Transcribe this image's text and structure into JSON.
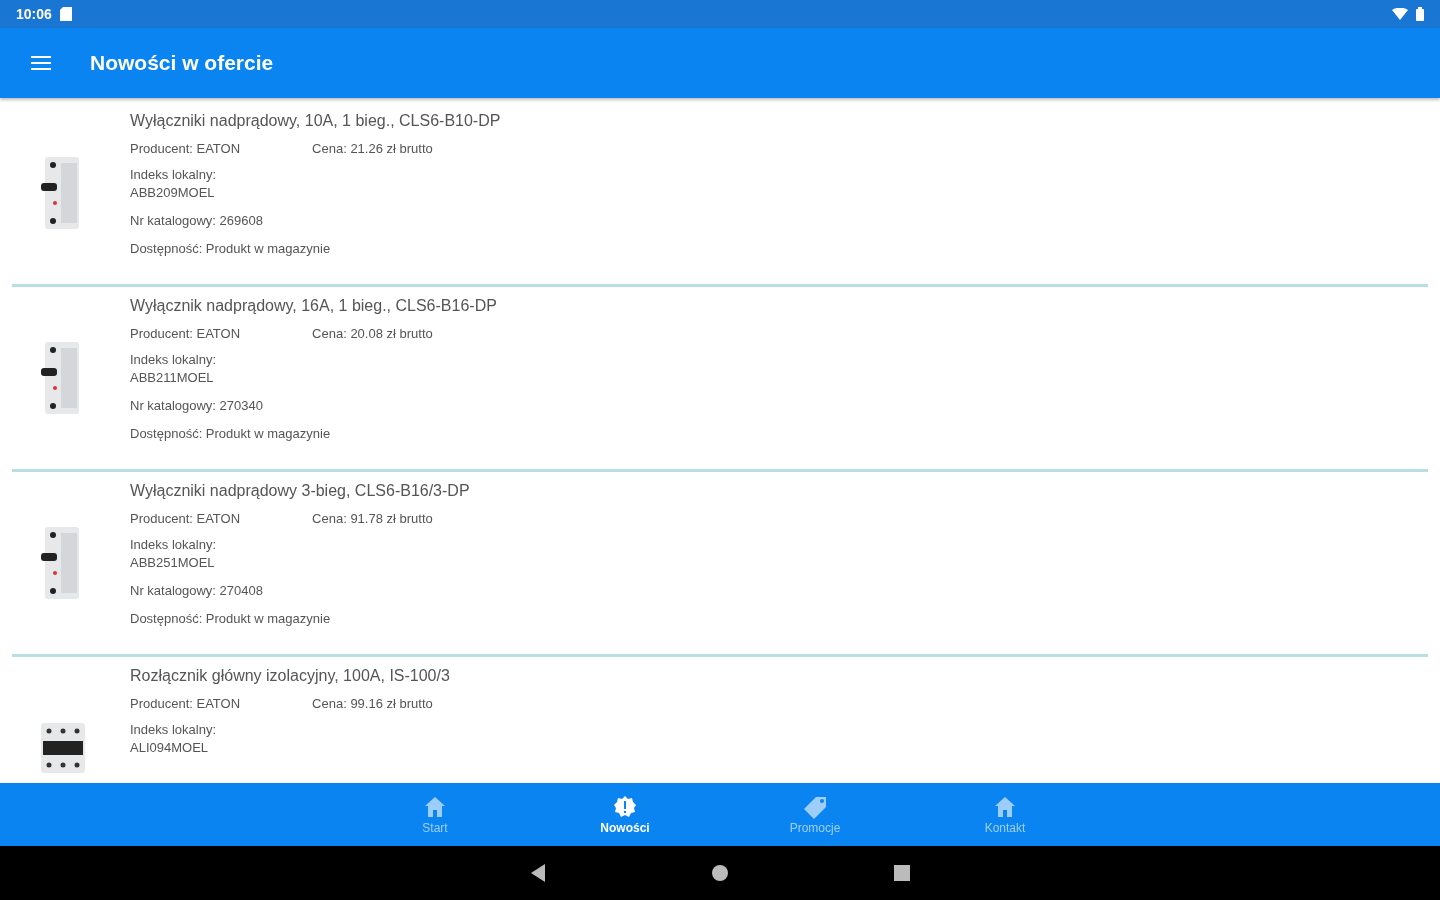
{
  "status_bar": {
    "time": "10:06"
  },
  "app_bar": {
    "title": "Nowości w ofercie"
  },
  "products": [
    {
      "name": "Wyłączniki nadprądowy, 10A, 1 bieg., CLS6-B10-DP",
      "producer": "Producent: EATON",
      "price": "Cena: 21.26 zł brutto",
      "local_index_label": "Indeks lokalny:",
      "local_index": "ABB209MOEL",
      "catalog_no": "Nr katalogowy: 269608",
      "availability": "Dostępność: Produkt w magazynie",
      "kind": "single"
    },
    {
      "name": "Wyłącznik nadprądowy, 16A, 1 bieg., CLS6-B16-DP",
      "producer": "Producent: EATON",
      "price": "Cena: 20.08 zł brutto",
      "local_index_label": "Indeks lokalny:",
      "local_index": "ABB211MOEL",
      "catalog_no": "Nr katalogowy: 270340",
      "availability": "Dostępność: Produkt w magazynie",
      "kind": "single"
    },
    {
      "name": "Wyłączniki nadprądowy 3-bieg, CLS6-B16/3-DP",
      "producer": "Producent: EATON",
      "price": "Cena: 91.78 zł brutto",
      "local_index_label": "Indeks lokalny:",
      "local_index": "ABB251MOEL",
      "catalog_no": "Nr katalogowy: 270408",
      "availability": "Dostępność: Produkt w magazynie",
      "kind": "single"
    },
    {
      "name": "Rozłącznik główny izolacyjny, 100A, IS-100/3",
      "producer": "Producent: EATON",
      "price": "Cena: 99.16 zł brutto",
      "local_index_label": "Indeks lokalny:",
      "local_index": "ALI094MOEL",
      "kind": "triple"
    }
  ],
  "bottom_nav": [
    {
      "label": "Start",
      "kind": "home",
      "selected": false
    },
    {
      "label": "Nowości",
      "kind": "news",
      "selected": true
    },
    {
      "label": "Promocje",
      "kind": "promo",
      "selected": false
    },
    {
      "label": "Kontakt",
      "kind": "home",
      "selected": false
    }
  ]
}
